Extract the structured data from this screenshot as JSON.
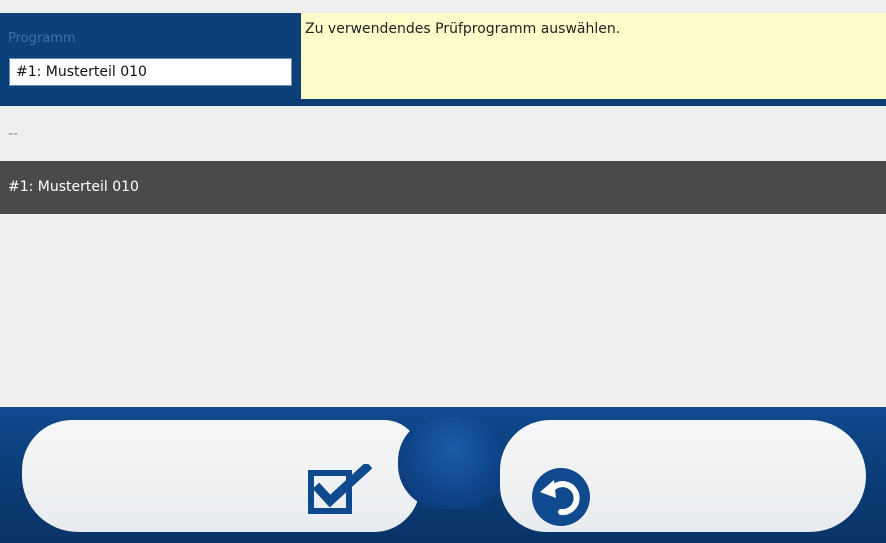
{
  "header": {
    "program_label": "Programm",
    "program_value": "#1: Musterteil 010",
    "hint_text": "Zu verwendendes Prüfprogramm auswählen."
  },
  "list": {
    "items": [
      {
        "label": "--"
      },
      {
        "label": "#1: Musterteil 010",
        "selected": true
      }
    ]
  },
  "footer": {
    "confirm_icon": "checkbox-check-icon",
    "back_icon": "undo-arrow-icon"
  },
  "colors": {
    "primary_blue": "#0b3f7a",
    "hint_background": "#fffcca",
    "selected_row": "#4a4a4a",
    "list_background": "#eef0f0"
  }
}
